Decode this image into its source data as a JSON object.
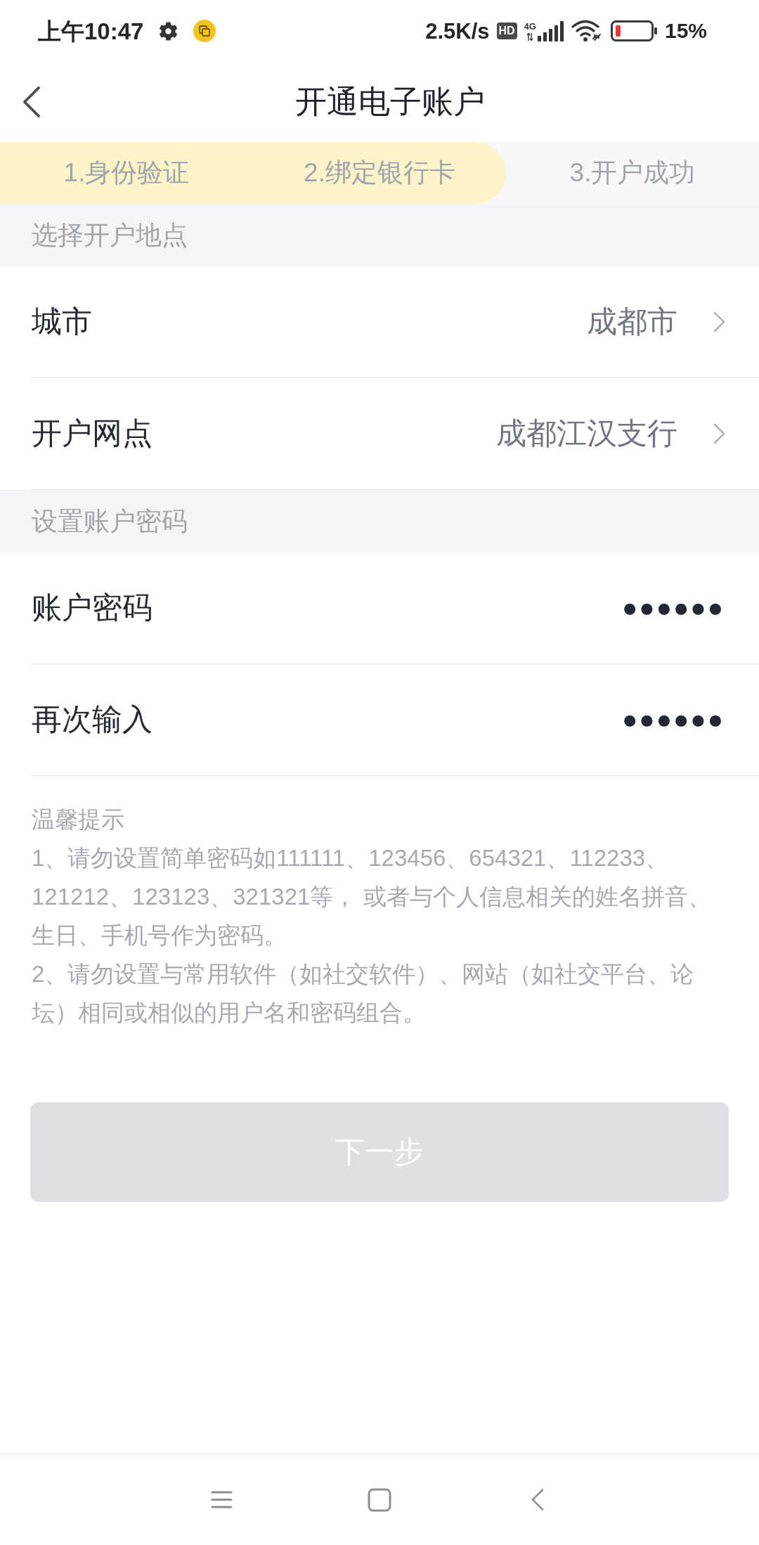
{
  "status_bar": {
    "time": "上午10:47",
    "net_speed": "2.5K/s",
    "hd_badge": "HD",
    "network_type": "4G",
    "battery": "15%"
  },
  "header": {
    "title": "开通电子账户"
  },
  "steps": [
    {
      "label": "1.身份验证",
      "reached": true
    },
    {
      "label": "2.绑定银行卡",
      "reached": true
    },
    {
      "label": "3.开户成功",
      "reached": false
    }
  ],
  "sections": [
    {
      "title": "选择开户地点",
      "rows": [
        {
          "kind": "select",
          "label": "城市",
          "value": "成都市"
        },
        {
          "kind": "select",
          "label": "开户网点",
          "value": "成都江汉支行"
        }
      ]
    },
    {
      "title": "设置账户密码",
      "rows": [
        {
          "kind": "password",
          "label": "账户密码",
          "value": "●●●●●●"
        },
        {
          "kind": "password",
          "label": "再次输入",
          "value": "●●●●●●"
        }
      ]
    }
  ],
  "tips": {
    "title": "温馨提示",
    "items": [
      "1、请勿设置简单密码如111111、123456、654321、112233、121212、123123、321321等， 或者与个人信息相关的姓名拼音、生日、手机号作为密码。",
      "2、请勿设置与常用软件（如社交软件）、网站（如社交平台、论坛）相同或相似的用户名和密码组合。"
    ]
  },
  "next_button": {
    "label": "下一步",
    "disabled": true
  }
}
